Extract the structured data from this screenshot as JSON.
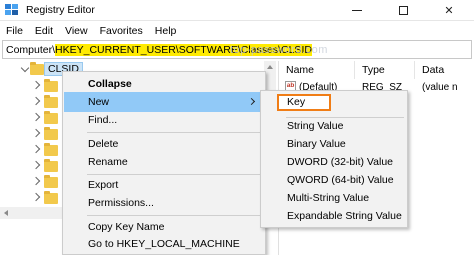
{
  "window": {
    "title": "Registry Editor",
    "icon": "registry-editor-icon"
  },
  "menubar": {
    "items": [
      "File",
      "Edit",
      "View",
      "Favorites",
      "Help"
    ]
  },
  "address": {
    "prefix": "Computer\\",
    "highlighted": "HKEY_CURRENT_USER\\SOFTWARE\\Classes\\CLSID",
    "highlight_color": "#ffeb00"
  },
  "watermark": "top-password.com",
  "tree": {
    "selected_key": "CLSID"
  },
  "values_pane": {
    "columns": [
      "Name",
      "Type",
      "Data"
    ],
    "rows": [
      {
        "name": "(Default)",
        "type": "REG_SZ",
        "data": "(value n"
      }
    ]
  },
  "context_menu": {
    "items": [
      {
        "label": "Collapse",
        "bold": true
      },
      {
        "label": "New",
        "submenu": true,
        "active": true
      },
      {
        "label": "Find..."
      },
      {
        "label": "Delete"
      },
      {
        "label": "Rename"
      },
      {
        "label": "Export"
      },
      {
        "label": "Permissions..."
      },
      {
        "label": "Copy Key Name"
      },
      {
        "label": "Go to HKEY_LOCAL_MACHINE"
      }
    ]
  },
  "submenu": {
    "items": [
      {
        "label": "Key",
        "highlighted": true
      },
      {
        "label": "String Value"
      },
      {
        "label": "Binary Value"
      },
      {
        "label": "DWORD (32-bit) Value"
      },
      {
        "label": "QWORD (64-bit) Value"
      },
      {
        "label": "Multi-String Value"
      },
      {
        "label": "Expandable String Value"
      }
    ],
    "highlight_color": "#f07d16"
  }
}
